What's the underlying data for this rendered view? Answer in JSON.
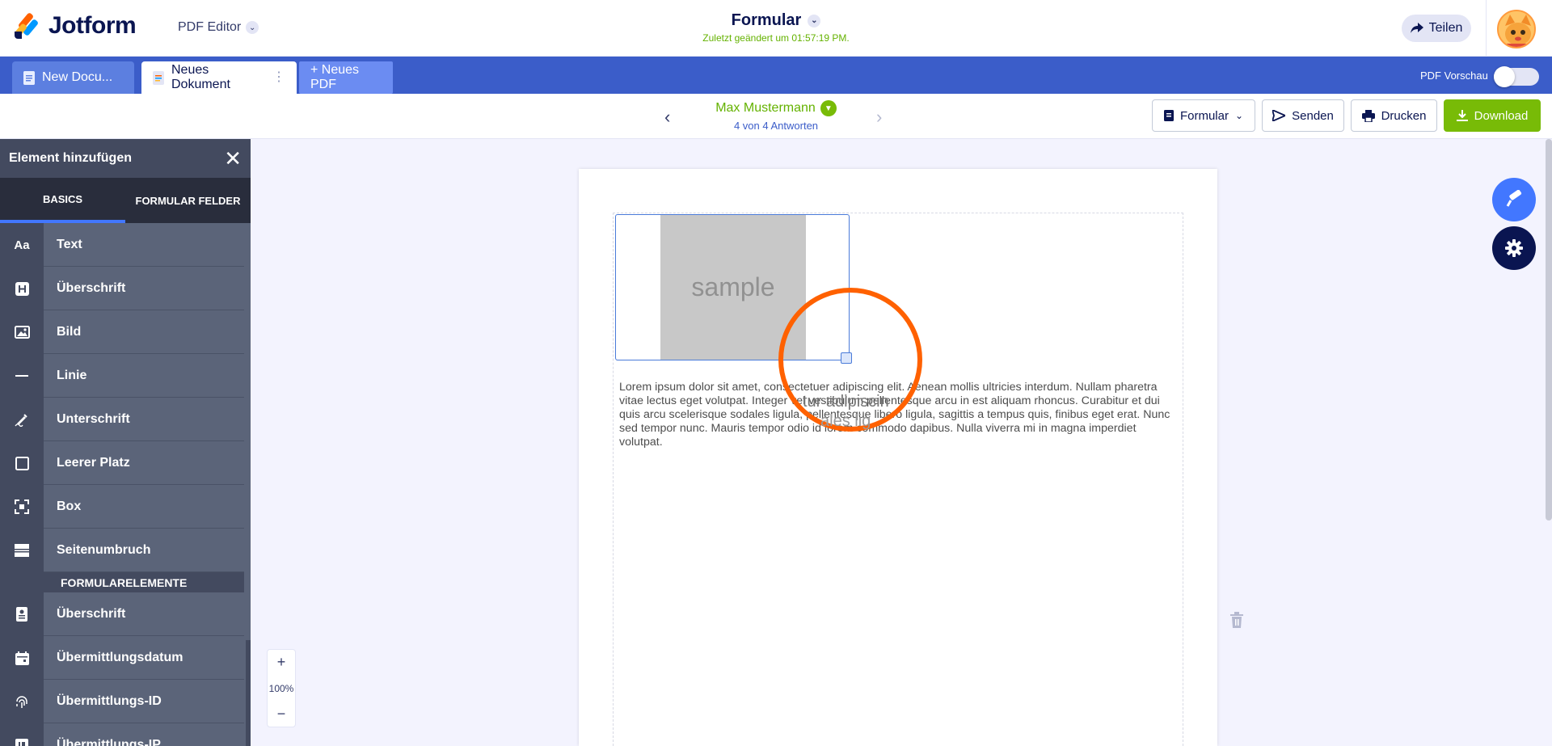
{
  "header": {
    "logo_text": "Jotform",
    "app_name": "PDF Editor",
    "doc_title": "Formular",
    "last_modified": "Zuletzt geändert um 01:57:19 PM.",
    "share_label": "Teilen"
  },
  "tabs": [
    {
      "label": "New Docu..."
    },
    {
      "label": "Neues Dokument"
    },
    {
      "label": "+ Neues PDF"
    }
  ],
  "preview": {
    "label": "PDF Vorschau",
    "enabled": false
  },
  "submission": {
    "name": "Max Mustermann",
    "count": "4 von 4 Antworten"
  },
  "actions": {
    "form": "Formular",
    "send": "Senden",
    "print": "Drucken",
    "download": "Download"
  },
  "panel": {
    "title": "Element hinzufügen",
    "tabs": [
      "BASICS",
      "FORMULAR FELDER"
    ],
    "basics": [
      {
        "label": "Text",
        "icon": "Aa"
      },
      {
        "label": "Überschrift",
        "icon": "heading-icon"
      },
      {
        "label": "Bild",
        "icon": "image-icon"
      },
      {
        "label": "Linie",
        "icon": "line-icon"
      },
      {
        "label": "Unterschrift",
        "icon": "signature-icon"
      },
      {
        "label": "Leerer Platz",
        "icon": "empty-space-icon"
      },
      {
        "label": "Box",
        "icon": "box-icon"
      },
      {
        "label": "Seitenumbruch",
        "icon": "page-break-icon"
      }
    ],
    "section_label": "FORMULARELEMENTE",
    "form_elements": [
      {
        "label": "Überschrift",
        "icon": "form-heading-icon"
      },
      {
        "label": "Übermittlungsdatum",
        "icon": "calendar-icon"
      },
      {
        "label": "Übermittlungs-ID",
        "icon": "fingerprint-icon"
      },
      {
        "label": "Übermittlungs-IP",
        "icon": "ip-icon"
      }
    ]
  },
  "zoom": {
    "plus": "+",
    "level": "100%",
    "minus": "−"
  },
  "document": {
    "image_placeholder": "sample",
    "paragraph": "Lorem ipsum dolor sit amet, consectetuer adipiscing elit. Aenean mollis ultricies interdum. Nullam pharetra vitae lectus eget volutpat. Integer vel vestibulum pellentesque arcu in est aliquam rhoncus. Curabitur et dui quis arcu scelerisque sodales ligula, pellentesque libero ligula, sagittis a tempus quis, finibus eget erat. Nunc sed tempor nunc. Mauris tempor odio id lorem commodo dapibus. Nulla viverra mi in magna imperdiet volutpat.",
    "ghost_line1": "tur adipiscin",
    "ghost_line2": "ales lig"
  },
  "colors": {
    "brand_blue": "#3b5dc9",
    "accent_green": "#78bb07",
    "highlight_orange": "#ff6100"
  }
}
